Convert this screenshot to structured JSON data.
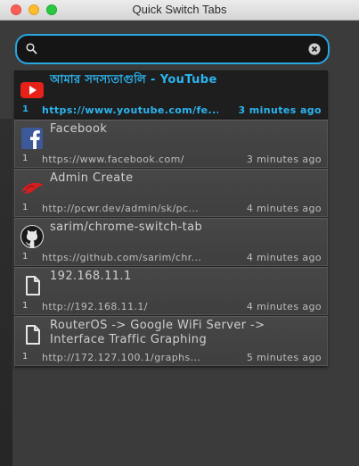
{
  "window": {
    "title": "Quick Switch Tabs"
  },
  "search": {
    "value": "",
    "placeholder": ""
  },
  "tabs": [
    {
      "index": "1",
      "title": "আমার সদস্যতাগুলি - YouTube",
      "url": "https://www.youtube.com/fe...",
      "time": "3 minutes ago",
      "icon": "youtube-icon",
      "selected": true
    },
    {
      "index": "1",
      "title": "Facebook",
      "url": "https://www.facebook.com/",
      "time": "3 minutes ago",
      "icon": "facebook-icon"
    },
    {
      "index": "1",
      "title": "Admin Create",
      "url": "http://pcwr.dev/admin/sk/pc...",
      "time": "4 minutes ago",
      "icon": "red-bird-icon"
    },
    {
      "index": "1",
      "title": "sarim/chrome-switch-tab",
      "url": "https://github.com/sarim/chr...",
      "time": "4 minutes ago",
      "icon": "github-icon"
    },
    {
      "index": "1",
      "title": "192.168.11.1",
      "url": "http://192.168.11.1/",
      "time": "4 minutes ago",
      "icon": "document-icon"
    },
    {
      "index": "1",
      "title": "RouterOS -> Google WiFi Server -> Interface Traffic Graphing",
      "url": "http://172.127.100.1/graphs...",
      "time": "5 minutes ago",
      "icon": "document-icon"
    }
  ],
  "colors": {
    "accent": "#27a7e0",
    "selected_text": "#2bb5f0"
  }
}
